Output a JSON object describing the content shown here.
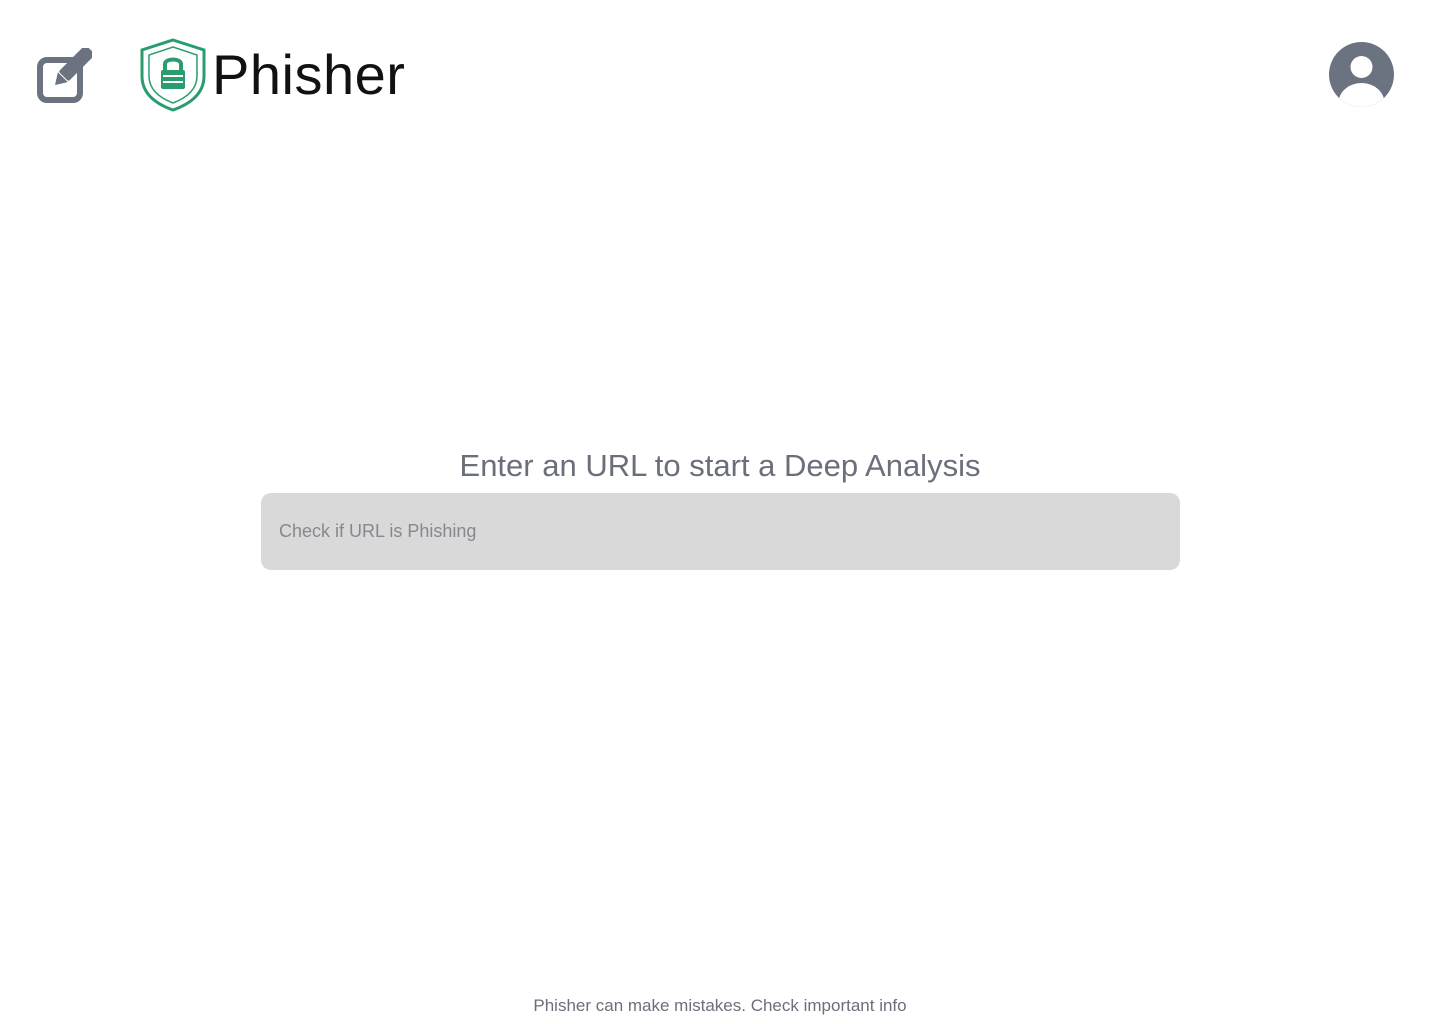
{
  "header": {
    "brand_name": "Phisher",
    "new_analysis_icon": "edit-icon",
    "logo_icon": "shield-lock-icon",
    "account_icon": "user-circle-icon"
  },
  "main": {
    "prompt": "Enter an URL to start a Deep Analysis",
    "url_input": {
      "placeholder": "Check if URL is Phishing",
      "value": ""
    }
  },
  "footer": {
    "disclaimer": "Phisher can make mistakes. Check important info"
  },
  "colors": {
    "icon_gray": "#6b7280",
    "brand_green": "#2a9d6f",
    "input_bg": "#d9d9d9",
    "muted_text": "#6b6f7b"
  }
}
